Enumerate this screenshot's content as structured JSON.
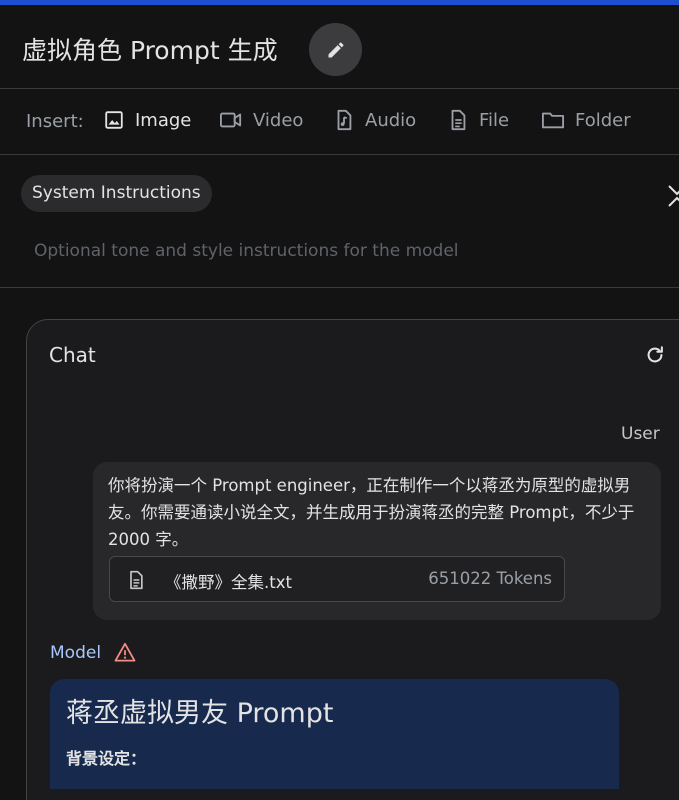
{
  "header": {
    "title": "虚拟角色 Prompt 生成",
    "edit_icon": "pencil-icon"
  },
  "insert": {
    "label": "Insert:",
    "items": [
      {
        "label": "Image",
        "icon": "image-icon",
        "active": true
      },
      {
        "label": "Video",
        "icon": "video-icon",
        "active": false
      },
      {
        "label": "Audio",
        "icon": "audio-icon",
        "active": false
      },
      {
        "label": "File",
        "icon": "file-icon",
        "active": false
      },
      {
        "label": "Folder",
        "icon": "folder-icon",
        "active": false
      }
    ]
  },
  "system": {
    "chip_label": "System Instructions",
    "placeholder": "Optional tone and style instructions for the model"
  },
  "chat": {
    "title": "Chat",
    "user_label": "User",
    "user_message": "你将扮演一个 Prompt engineer，正在制作一个以蒋丞为原型的虚拟男友。你需要通读小说全文，并生成用于扮演蒋丞的完整 Prompt，不少于 2000 字。",
    "attachment": {
      "name": "《撒野》全集.txt",
      "tokens": "651022 Tokens"
    },
    "model_label": "Model",
    "model_heading": "蒋丞虚拟男友 Prompt",
    "model_subheading": "背景设定："
  },
  "colors": {
    "background": "#131314",
    "accent_bar": "#1f4fd1",
    "model_label": "#a8c7fa",
    "warning": "#f28b82",
    "model_card": "#172a4e"
  }
}
